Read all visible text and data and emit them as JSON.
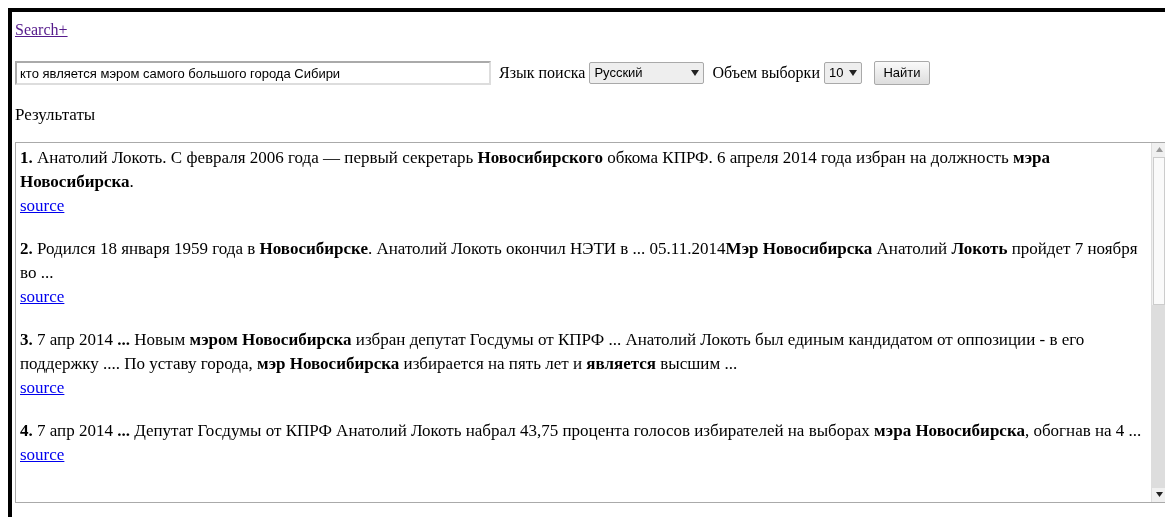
{
  "header_link": "Search+",
  "search": {
    "value": "кто является мэром самого большого города Сибири",
    "language_label": "Язык поиска",
    "language": "Русский",
    "size_label": "Объем выборки",
    "size": "10",
    "submit": "Найти"
  },
  "results_title": "Результаты",
  "results": [
    {
      "number": "1.",
      "text": "Анатолий Локоть. С февраля 2006 года — первый секретарь **Новосибирского** обкома КПРФ. 6 апреля 2014 года избран на должность **мэра Новосибирска**.",
      "link": "source"
    },
    {
      "number": "2.",
      "text": "Родился 18 января 1959 года в **Новосибирске**. Анатолий Локоть окончил НЭТИ в ... 05.11.2014**Мэр Новосибирска** Анатолий **Локоть** пройдет 7 ноября во ...",
      "link": "source"
    },
    {
      "number": "3.",
      "text": "7 апр 2014 **...** Новым **мэром Новосибирска** избран депутат Госдумы от КПРФ ... Анатолий Локоть был единым кандидатом от оппозиции - в его поддержку .... По уставу города, **мэр Новосибирска** избирается на пять лет и **является** высшим ...",
      "link": "source"
    },
    {
      "number": "4.",
      "text": "7 апр 2014 **...** Депутат Госдумы от КПРФ Анатолий Локоть набрал 43,75 процента голосов избирателей на выборах **мэра Новосибирска**, обогнав на 4 ...",
      "link": "source"
    }
  ]
}
